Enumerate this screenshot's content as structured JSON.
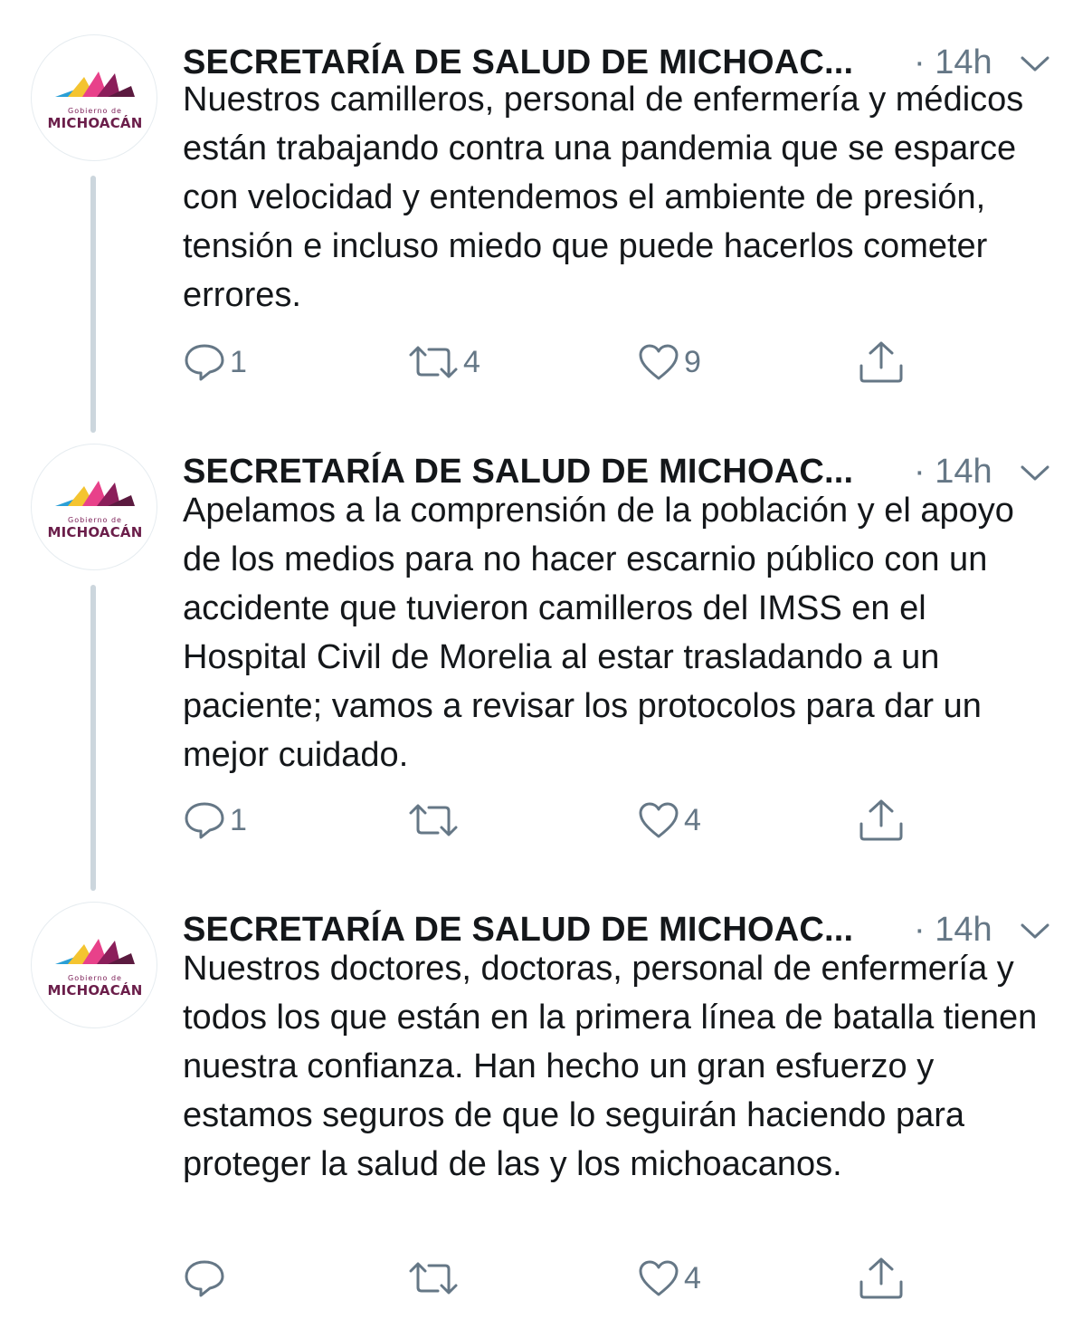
{
  "tweets": [
    {
      "author": "SECRETARÍA DE SALUD DE MICHOAC...",
      "time": "· 14h",
      "text": "Nuestros camilleros, personal de enfermería y médicos están trabajando contra una pandemia que se esparce con velocidad y entendemos el ambiente de presión, tensión e incluso miedo que puede hacerlos cometer errores.",
      "replies": "1",
      "retweets": "4",
      "likes": "9"
    },
    {
      "author": "SECRETARÍA DE SALUD DE MICHOAC...",
      "time": "· 14h",
      "text": "Apelamos a la comprensión de la población y el apoyo de los medios para no hacer escarnio público con un accidente que tuvieron camilleros del IMSS en el Hospital Civil de Morelia al estar trasladando a un paciente; vamos a revisar los protocolos para dar un mejor cuidado.",
      "replies": "1",
      "retweets": "",
      "likes": "4"
    },
    {
      "author": "SECRETARÍA DE SALUD DE MICHOAC...",
      "time": "· 14h",
      "text": "Nuestros doctores, doctoras, personal de enfermería y todos los que están en la primera línea de batalla tienen nuestra confianza. Han hecho un gran esfuerzo y estamos seguros de que lo seguirán haciendo para proteger la salud de las y los michoacanos.",
      "replies": "",
      "retweets": "",
      "likes": "4"
    }
  ],
  "avatar": {
    "small_text": "Gobierno de",
    "big_text": "MICHOACÁN",
    "logo": "michoacan-government-logo"
  },
  "icons": {
    "reply": "reply-icon",
    "retweet": "retweet-icon",
    "like": "heart-icon",
    "share": "share-icon",
    "menu": "chevron-down-icon"
  },
  "colors": {
    "text": "#14171a",
    "muted": "#657786",
    "thread_line": "#ccd6dd"
  }
}
